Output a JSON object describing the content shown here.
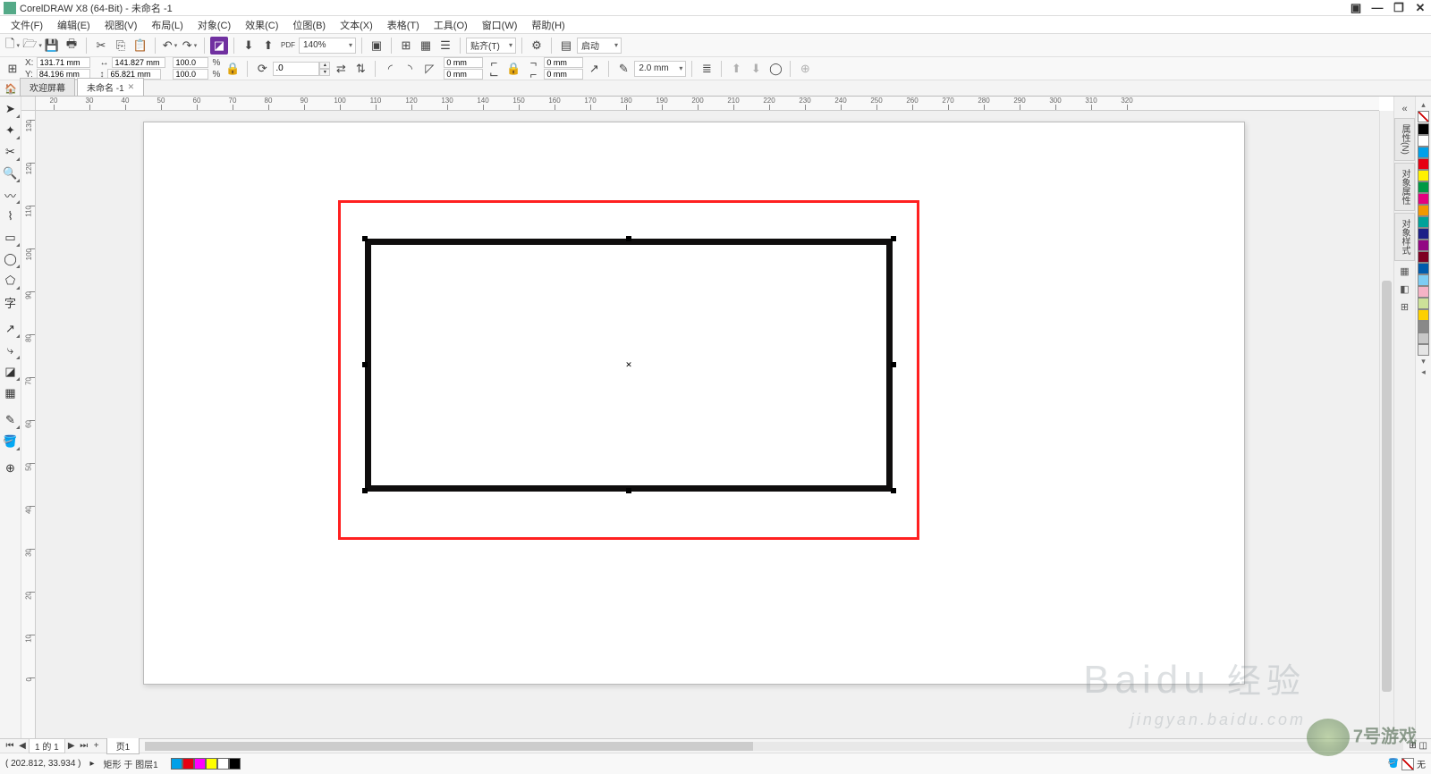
{
  "title": "CorelDRAW X8 (64-Bit) - 未命名 -1",
  "menu": [
    "文件(F)",
    "编辑(E)",
    "视图(V)",
    "布局(L)",
    "对象(C)",
    "效果(C)",
    "位图(B)",
    "文本(X)",
    "表格(T)",
    "工具(O)",
    "窗口(W)",
    "帮助(H)"
  ],
  "toolbar1": {
    "zoom": "140%",
    "snap_label": "贴齐(T)",
    "launch_label": "启动"
  },
  "propbar": {
    "x_label": "X:",
    "y_label": "Y:",
    "x": "131.71 mm",
    "y": "84.196 mm",
    "w": "141.827 mm",
    "h": "65.821 mm",
    "sx": "100.0",
    "sy": "100.0",
    "pct": "%",
    "rot": ".0",
    "corner1": "0 mm",
    "corner2": "0 mm",
    "corner3": "0 mm",
    "corner4": "0 mm",
    "outline": "2.0 mm"
  },
  "doctabs": {
    "welcome": "欢迎屏幕",
    "doc1": "未命名 -1"
  },
  "hruler_ticks": [
    20,
    30,
    40,
    50,
    60,
    70,
    80,
    90,
    100,
    110,
    120,
    130,
    140,
    150,
    160,
    170,
    180,
    190,
    200,
    210,
    220,
    230,
    240,
    250,
    260,
    270,
    280,
    290,
    300,
    310,
    320
  ],
  "vruler_ticks": [
    130,
    120,
    110,
    100,
    90,
    80,
    70,
    60,
    50,
    40,
    30,
    20,
    10,
    0
  ],
  "pagenav": {
    "pageinfo": "1 的 1",
    "plus": "+",
    "pagetab": "页1"
  },
  "statusbar": {
    "coords": "( 202.812, 33.934 )",
    "arrow": "▸",
    "obj": "矩形 于 图层1",
    "fill_none": "无"
  },
  "palette": [
    "#000000",
    "#ffffff",
    "#00a0e8",
    "#e60012",
    "#fff100",
    "#009944",
    "#e3007f",
    "#f39800",
    "#00a29a",
    "#1d2087",
    "#920783",
    "#7e0022",
    "#005bac",
    "#7dccf3",
    "#f5b3c6",
    "#cce198",
    "#fdd000",
    "#898989",
    "#c8c8c8",
    "#e5e5e5"
  ],
  "docker_tabs": [
    "属性(N)",
    "对象属性",
    "对象样式"
  ],
  "bottom_palette": [
    "#00a0e8",
    "#e60012",
    "#ff00ff",
    "#ffff00",
    "#ffffff",
    "#000000"
  ],
  "watermark1a": "Baidu",
  "watermark1b": "经验",
  "watermark2": "jingyan.baidu.com",
  "watermark3": "7号游戏"
}
